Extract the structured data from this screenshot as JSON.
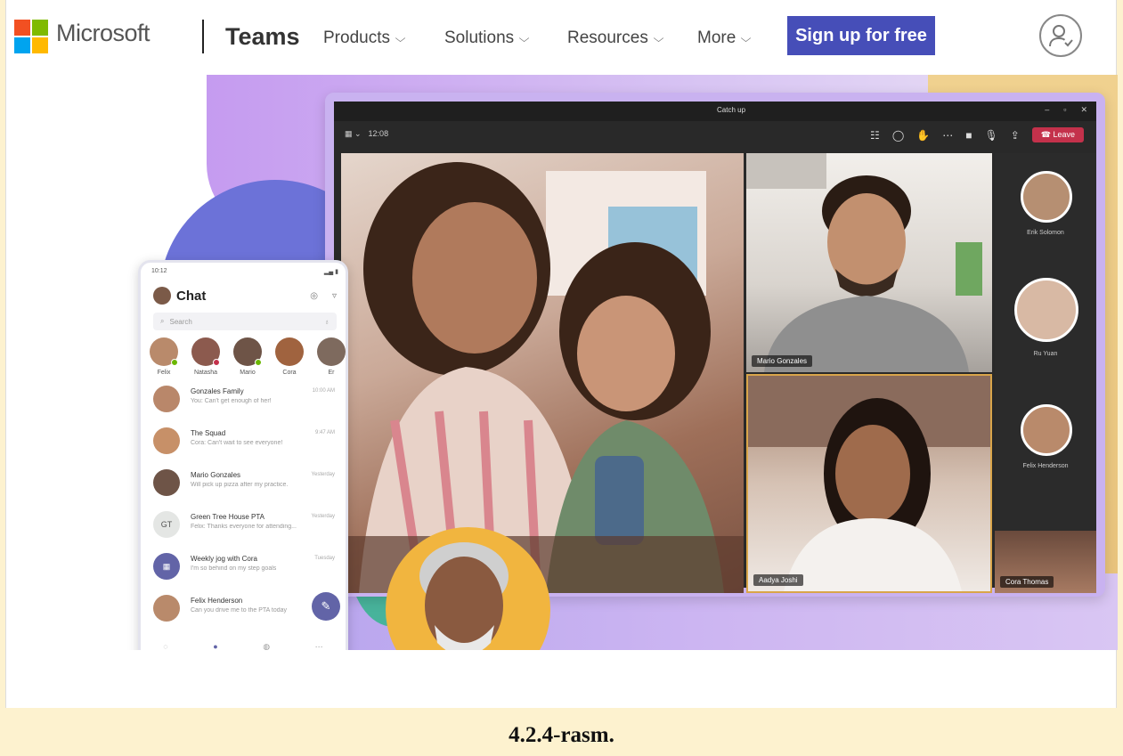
{
  "nav": {
    "brand": "Microsoft",
    "product": "Teams",
    "items": [
      {
        "label": "Products",
        "icon": "chevron-down-icon"
      },
      {
        "label": "Solutions",
        "icon": "chevron-down-icon"
      },
      {
        "label": "Resources",
        "icon": "chevron-down-icon"
      },
      {
        "label": "More",
        "icon": "chevron-down-icon"
      }
    ],
    "cta_label": "Sign up for free",
    "account_icon": "account-icon",
    "logo_colors": [
      "#f25022",
      "#7fba00",
      "#00a4ef",
      "#ffb900"
    ]
  },
  "meeting": {
    "title": "Catch up",
    "time": "12:08",
    "leave_label": "Leave",
    "participants": [
      "Mario Gonzales",
      "Aadya Joshi",
      "Cora Thomas"
    ],
    "side_participants": [
      "Erik Solomon",
      "Ru Yuan",
      "Felix Henderson"
    ]
  },
  "phone": {
    "status_time": "10:12",
    "title": "Chat",
    "search_placeholder": "Search",
    "contacts": [
      {
        "name": "Felix",
        "color": "#b98a6b"
      },
      {
        "name": "Natasha",
        "color": "#8c5a4e"
      },
      {
        "name": "Mario",
        "color": "#6e5447"
      },
      {
        "name": "Cora",
        "color": "#a0633f"
      },
      {
        "name": "Er",
        "color": "#7e6a5e"
      }
    ],
    "chats": [
      {
        "name": "Gonzales Family",
        "message": "You: Can't get enough of her!",
        "time": "10:00 AM",
        "color": "#b9876a"
      },
      {
        "name": "The Squad",
        "message": "Cora: Can't wait to see everyone!",
        "time": "9:47 AM",
        "color": "#c79068"
      },
      {
        "name": "Mario Gonzales",
        "message": "Will pick up pizza after my practice.",
        "time": "Yesterday",
        "color": "#6e5447"
      },
      {
        "name": "Green Tree House PTA",
        "message": "Felix: Thanks everyone for attending...",
        "time": "Yesterday",
        "color": "#e4e6e4",
        "initials": "GT"
      },
      {
        "name": "Weekly jog with Cora",
        "message": "I'm so behind on my step goals",
        "time": "Tuesday",
        "color": "#6264a7"
      },
      {
        "name": "Felix Henderson",
        "message": "Can you drive me to the PTA today",
        "time": "",
        "color": "#b98a6b"
      }
    ],
    "tabs": [
      "Activity",
      "Chat",
      "Teams",
      "More"
    ]
  },
  "caption": "4.2.4-rasm."
}
